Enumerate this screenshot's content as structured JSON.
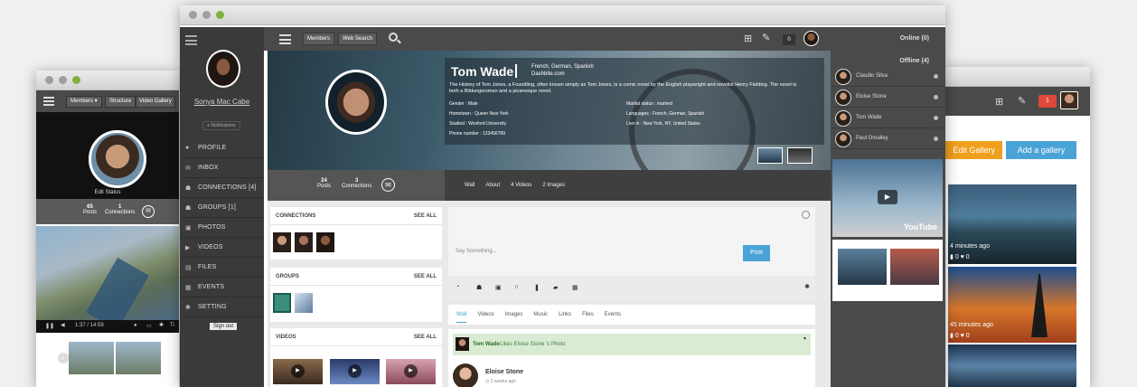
{
  "left_window": {
    "nav": {
      "members_label": "Members ▾",
      "structure_label": "Structure",
      "video_gallery_label": "Video Gallery"
    },
    "edit_status_label": "Edit Status",
    "stats": {
      "posts_count": "65",
      "posts_label": "Posts",
      "connections_count": "1",
      "connections_label": "Connections"
    },
    "video_time": "1:37 / 14:59",
    "video_trailing_label": "Ti"
  },
  "right_window": {
    "notification_count": "1",
    "edit_gallery_label": "Edit Gallery",
    "add_gallery_label": "Add a gallery",
    "items": [
      {
        "time": "4 minutes ago",
        "comments": "0",
        "likes": "0"
      },
      {
        "time": "45 minutes ago",
        "comments": "0",
        "likes": "0"
      }
    ]
  },
  "main_window": {
    "topbar": {
      "members_label": "Members",
      "web_search_label": "Web Search",
      "badge_count": "0",
      "online_label": "Online (0)",
      "offline_label": "Offline (4)"
    },
    "sidebar": {
      "user_name": "Sonya Mac Cabe",
      "notifications_label": "Notifications",
      "items": [
        {
          "label": "PROFILE",
          "icon": "user-icon"
        },
        {
          "label": "INBOX",
          "icon": "mail-icon"
        },
        {
          "label": "CONNECTIONS [4]",
          "icon": "people-icon"
        },
        {
          "label": "GROUPS [1]",
          "icon": "group-icon"
        },
        {
          "label": "PHOTOS",
          "icon": "camera-icon"
        },
        {
          "label": "VIDEOS",
          "icon": "video-icon"
        },
        {
          "label": "FILES",
          "icon": "file-icon"
        },
        {
          "label": "EVENTS",
          "icon": "calendar-icon"
        },
        {
          "label": "SETTING",
          "icon": "gear-icon"
        }
      ],
      "sign_out_label": "Sign out"
    },
    "profile": {
      "name": "Tom Wade",
      "languages": "French, German, Spanish",
      "site": "Dashbite.com",
      "bio": "The History of Tom Jones, a Foundling, often known simply as Tom Jones, is a comic novel by the English playwright and novelist Henry Fielding. The novel is both a Bildungsroman and a picaresque novel.",
      "details_left": [
        "Gender : Male",
        "Hometown : Queen New York",
        "Studied : Wexford University",
        "Phone number : 123456789"
      ],
      "details_right": [
        "Marital status : married",
        "Languages : French, German, Spanish",
        "Live in : New York, NY, United States"
      ],
      "posts_count": "24",
      "posts_label": "Posts",
      "connections_count": "3",
      "connections_label": "Connections",
      "tabs": [
        "Wall",
        "About",
        "4 Videos",
        "2 Images"
      ]
    },
    "panels": {
      "connections_title": "CONNECTIONS",
      "groups_title": "GROUPS",
      "videos_title": "VIDEOS",
      "see_all_label": "SEE ALL"
    },
    "composer": {
      "placeholder": "Say Something...",
      "post_label": "Post",
      "filter_tabs": [
        "Wall",
        "Videos",
        "Images",
        "Music",
        "Links",
        "Files",
        "Events"
      ]
    },
    "feed": {
      "activity_actor": "Tom Wade",
      "activity_text": "Likes Eloise Stone 's  Photo",
      "post_author": "Eloise Stone",
      "post_time": "2 weeks ago"
    },
    "contacts": [
      {
        "name": "Claudio Silva"
      },
      {
        "name": "Eloise Stone"
      },
      {
        "name": "Tom Wade"
      },
      {
        "name": "Paul Omalley"
      }
    ],
    "youtube_label": "YouTube"
  },
  "colors": {
    "accent_blue": "#4aa3d6",
    "orange": "#f0a01e",
    "dark": "#3a3a3a",
    "green_highlight": "#d9ecd3"
  }
}
